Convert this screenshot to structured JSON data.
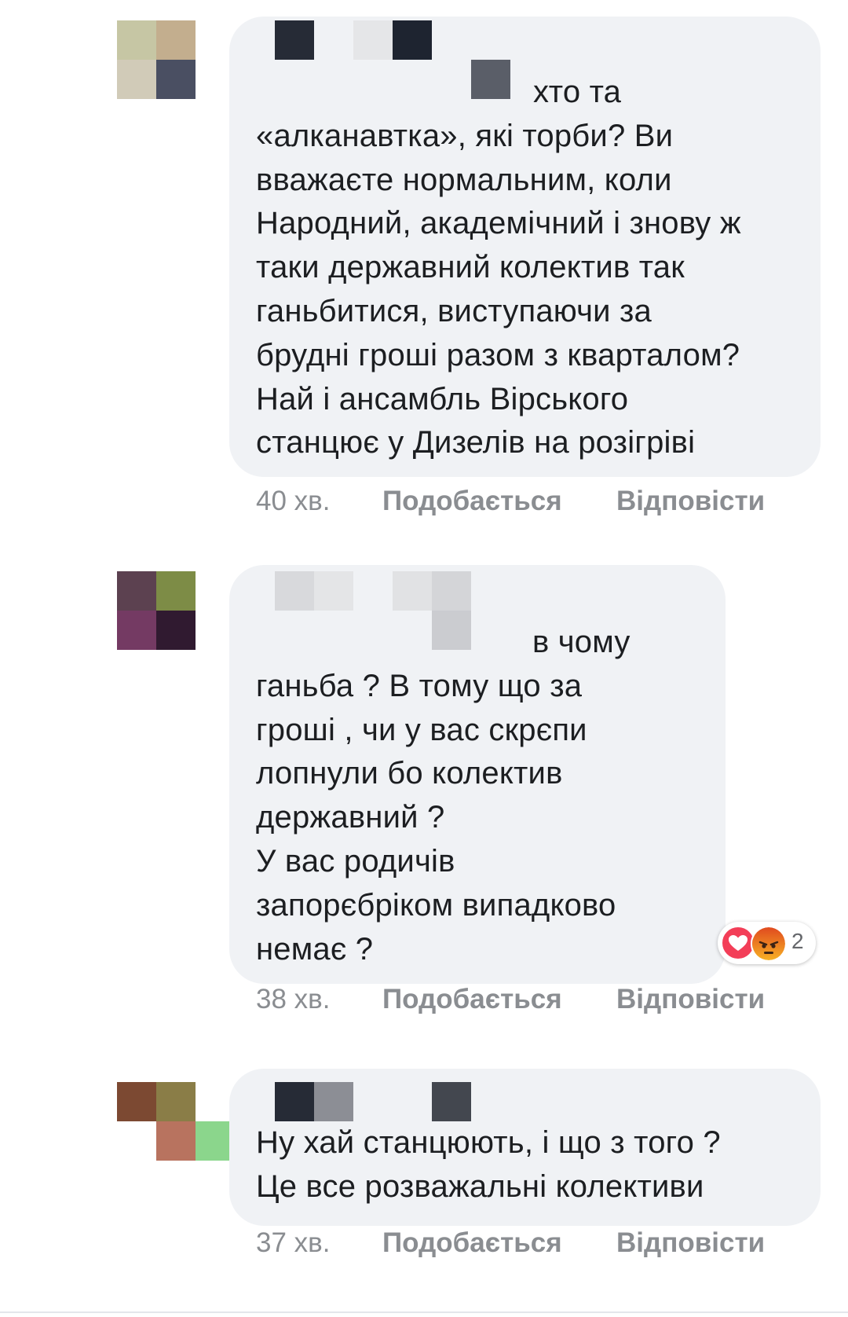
{
  "comments": [
    {
      "text": "хто та\n«алканавтка», які торби? Ви\nвважаєте нормальним, коли\nНародний, академічний і знову ж\nтаки державний колектив так\nганьбитися, виступаючи за\nбрудні гроші разом з кварталом?\nНай і ансамбль Вірського\nстанцює у Дизелів на розігріві",
      "time": "40 хв.",
      "like_label": "Подобається",
      "reply_label": "Відповісти"
    },
    {
      "text": "в чому\nганьба ? В тому що за\nгроші , чи у вас скрєпи\nлопнули бо колектив\nдержавний ?\nУ вас родичів\nзапорєбріком випадково\nнемає ?",
      "time": "38 хв.",
      "like_label": "Подобається",
      "reply_label": "Відповісти",
      "reactions": {
        "icons": [
          "heart-icon",
          "angry-face-icon"
        ],
        "count": "2"
      }
    },
    {
      "text": "Ну хай станцюють, і що з того ?\nЦе все розважальні колективи",
      "time": "37 хв.",
      "like_label": "Подобається",
      "reply_label": "Відповісти"
    }
  ],
  "colors": {
    "bubble": "#f0f2f5",
    "text": "#1c1e21",
    "meta": "#8a8d91",
    "heart": "#f33e58",
    "angry": "#e9710f"
  }
}
